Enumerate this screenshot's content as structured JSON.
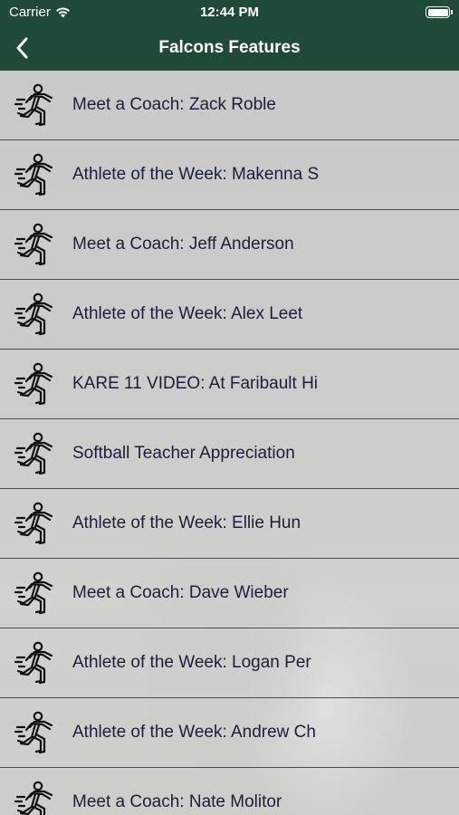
{
  "status_bar": {
    "carrier": "Carrier",
    "time": "12:44 PM"
  },
  "nav": {
    "title": "Falcons Features",
    "back_icon": "chevron-left-icon"
  },
  "colors": {
    "nav_background": "#1f4a35",
    "row_background": "#dedede",
    "text": "#1b1f3b"
  },
  "items": [
    {
      "label": "Meet a Coach: Zack Roble",
      "icon": "running-figure-icon"
    },
    {
      "label": "Athlete of the Week: Makenna S",
      "icon": "running-figure-icon"
    },
    {
      "label": "Meet a Coach: Jeff Anderson",
      "icon": "running-figure-icon"
    },
    {
      "label": "Athlete of the Week: Alex Leet",
      "icon": "running-figure-icon"
    },
    {
      "label": "KARE 11 VIDEO: At Faribault Hi",
      "icon": "running-figure-icon"
    },
    {
      "label": "Softball Teacher Appreciation",
      "icon": "running-figure-icon"
    },
    {
      "label": "Athlete of the Week: Ellie Hun",
      "icon": "running-figure-icon"
    },
    {
      "label": "Meet a Coach: Dave Wieber",
      "icon": "running-figure-icon"
    },
    {
      "label": "Athlete of the Week: Logan Per",
      "icon": "running-figure-icon"
    },
    {
      "label": "Athlete of the Week: Andrew Ch",
      "icon": "running-figure-icon"
    },
    {
      "label": "Meet a Coach: Nate Molitor",
      "icon": "running-figure-icon"
    }
  ]
}
